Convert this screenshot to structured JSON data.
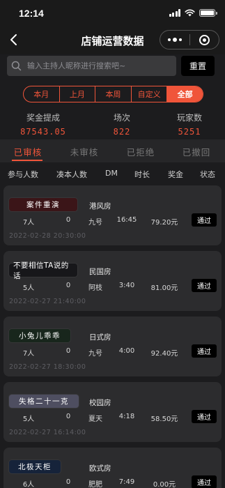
{
  "status_bar": {
    "time": "12:14"
  },
  "nav": {
    "title": "店铺运营数据"
  },
  "search": {
    "placeholder": "输入主持人昵称进行搜索吧~",
    "value": "",
    "reset_label": "重置"
  },
  "period_tabs": [
    {
      "label": "本月",
      "active": false
    },
    {
      "label": "上月",
      "active": false
    },
    {
      "label": "本周",
      "active": false
    },
    {
      "label": "自定义",
      "active": false
    },
    {
      "label": "全部",
      "active": true
    }
  ],
  "stats": [
    {
      "label": "奖金提成",
      "value": "87543.05"
    },
    {
      "label": "场次",
      "value": "822"
    },
    {
      "label": "玩家数",
      "value": "5251"
    }
  ],
  "review_tabs": [
    {
      "label": "已审核",
      "active": true
    },
    {
      "label": "未审核",
      "active": false
    },
    {
      "label": "已拒绝",
      "active": false
    },
    {
      "label": "已撤回",
      "active": false
    }
  ],
  "columns": [
    "参与人数",
    "凑本人数",
    "DM",
    "时长",
    "奖金",
    "状态"
  ],
  "colors": {
    "accent": "#f0553a",
    "background": "#1c1c1e",
    "card": "#2c2c2e"
  },
  "records": [
    {
      "script": "案件重演",
      "badge_color": "#3b1518",
      "room": "港风房",
      "players": "7人",
      "extra": "0",
      "dm": "九号",
      "duration": "16:45",
      "bonus": "79.20元",
      "action": "通过",
      "date": "2022-02-28 20:30:00"
    },
    {
      "script": "不要相信TA说的话",
      "badge_color": "#17171a",
      "room": "民国房",
      "players": "5人",
      "extra": "0",
      "dm": "阿枝",
      "duration": "3:40",
      "bonus": "81.00元",
      "action": "通过",
      "date": "2022-02-27 21:40:00"
    },
    {
      "script": "小兔儿乖乖",
      "badge_color": "#18261c",
      "room": "日式房",
      "players": "7人",
      "extra": "0",
      "dm": "九号",
      "duration": "4:00",
      "bonus": "92.40元",
      "action": "通过",
      "date": "2022-02-27 18:30:00"
    },
    {
      "script": "失格二十一克",
      "badge_color": "#4e4e60",
      "room": "校园房",
      "players": "5人",
      "extra": "0",
      "dm": "夏天",
      "duration": "4:18",
      "bonus": "58.50元",
      "action": "通过",
      "date": "2022-02-27 16:14:00"
    },
    {
      "script": "北极天柜",
      "badge_color": "#16233a",
      "room": "欧式房",
      "players": "6人",
      "extra": "0",
      "dm": "肥肥",
      "duration": "7:49",
      "bonus": "0.00元",
      "action": "通过",
      "date": ""
    }
  ]
}
